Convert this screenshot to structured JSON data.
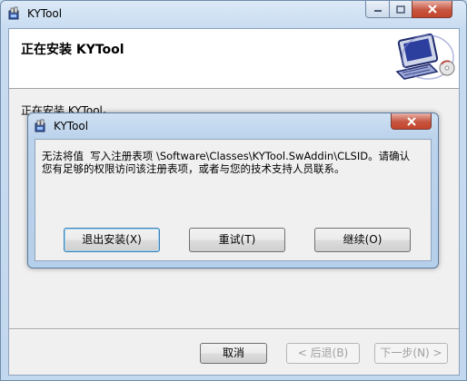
{
  "window": {
    "title": "KYTool",
    "icon": "installer-app-icon",
    "controls": {
      "minimize": "minimize-icon",
      "maximize": "maximize-icon",
      "close": "close-icon"
    }
  },
  "banner": {
    "title": "正在安装 KYTool",
    "art": "computer-install-graphic"
  },
  "progress": {
    "status": "正在安装 KYTool。"
  },
  "buttons": {
    "cancel": "取消",
    "back": "< 后退(B)",
    "next": "下一步(N) >"
  },
  "dialog": {
    "title": "KYTool",
    "message": "无法将值  写入注册表项 \\Software\\Classes\\KYTool.SwAddin\\CLSID。请确认\n您有足够的权限访问该注册表项，或者与您的技术支持人员联系。",
    "exit": "退出安装(X)",
    "retry": "重试(T)",
    "continue": "继续(O)"
  }
}
